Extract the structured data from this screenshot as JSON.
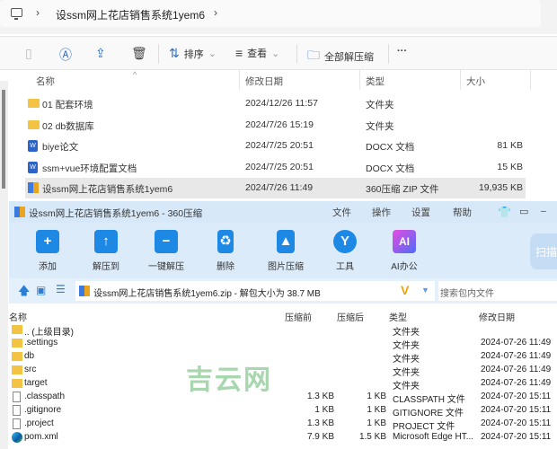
{
  "explorer": {
    "breadcrumb": "设ssm网上花店销售系统1yem6",
    "toolbar": {
      "sort": "排序",
      "view": "查看",
      "extract_all": "全部解压缩",
      "more": "···"
    },
    "columns": {
      "name": "名称",
      "date": "修改日期",
      "type": "类型",
      "size": "大小"
    },
    "files": [
      {
        "name": "01 配套环境",
        "date": "2024/12/26 11:57",
        "type": "文件夹",
        "size": "",
        "icon": "folder"
      },
      {
        "name": "02 db数据库",
        "date": "2024/7/26 15:19",
        "type": "文件夹",
        "size": "",
        "icon": "folder"
      },
      {
        "name": "biye论文",
        "date": "2024/7/25 20:51",
        "type": "DOCX 文档",
        "size": "81 KB",
        "icon": "docx"
      },
      {
        "name": "ssm+vue环境配置文档",
        "date": "2024/7/25 20:51",
        "type": "DOCX 文档",
        "size": "15 KB",
        "icon": "docx"
      },
      {
        "name": "设ssm网上花店销售系统1yem6",
        "date": "2024/7/26 11:49",
        "type": "360压缩 ZIP 文件",
        "size": "19,935 KB",
        "icon": "zip",
        "selected": true
      }
    ]
  },
  "zip": {
    "title": "设ssm网上花店销售系统1yem6 - 360压缩",
    "menu": [
      "文件",
      "操作",
      "设置",
      "帮助"
    ],
    "ribbon": [
      "添加",
      "解压到",
      "一键解压",
      "删除",
      "图片压缩",
      "工具",
      "AI办公"
    ],
    "scan": "扫描",
    "address": "设ssm网上花店销售系统1yem6.zip - 解包大小为 38.7 MB",
    "search_placeholder": "搜索包内文件",
    "columns": {
      "name": "名称",
      "before": "压缩前",
      "after": "压缩后",
      "type": "类型",
      "date": "修改日期"
    },
    "rows": [
      {
        "name": ".. (上级目录)",
        "before": "",
        "after": "",
        "type": "文件夹",
        "date": "",
        "icon": "folder"
      },
      {
        "name": ".settings",
        "before": "",
        "after": "",
        "type": "文件夹",
        "date": "2024-07-26 11:49",
        "icon": "folder"
      },
      {
        "name": "db",
        "before": "",
        "after": "",
        "type": "文件夹",
        "date": "2024-07-26 11:49",
        "icon": "folder"
      },
      {
        "name": "src",
        "before": "",
        "after": "",
        "type": "文件夹",
        "date": "2024-07-26 11:49",
        "icon": "folder"
      },
      {
        "name": "target",
        "before": "",
        "after": "",
        "type": "文件夹",
        "date": "2024-07-26 11:49",
        "icon": "folder"
      },
      {
        "name": ".classpath",
        "before": "1.3 KB",
        "after": "1 KB",
        "type": "CLASSPATH 文件",
        "date": "2024-07-20 15:11",
        "icon": "file"
      },
      {
        "name": ".gitignore",
        "before": "1 KB",
        "after": "1 KB",
        "type": "GITIGNORE 文件",
        "date": "2024-07-20 15:11",
        "icon": "file"
      },
      {
        "name": ".project",
        "before": "1.3 KB",
        "after": "1 KB",
        "type": "PROJECT 文件",
        "date": "2024-07-20 15:11",
        "icon": "file"
      },
      {
        "name": "pom.xml",
        "before": "7.9 KB",
        "after": "1.5 KB",
        "type": "Microsoft Edge HT...",
        "date": "2024-07-20 15:11",
        "icon": "edge"
      }
    ]
  },
  "watermark": "吉云网"
}
